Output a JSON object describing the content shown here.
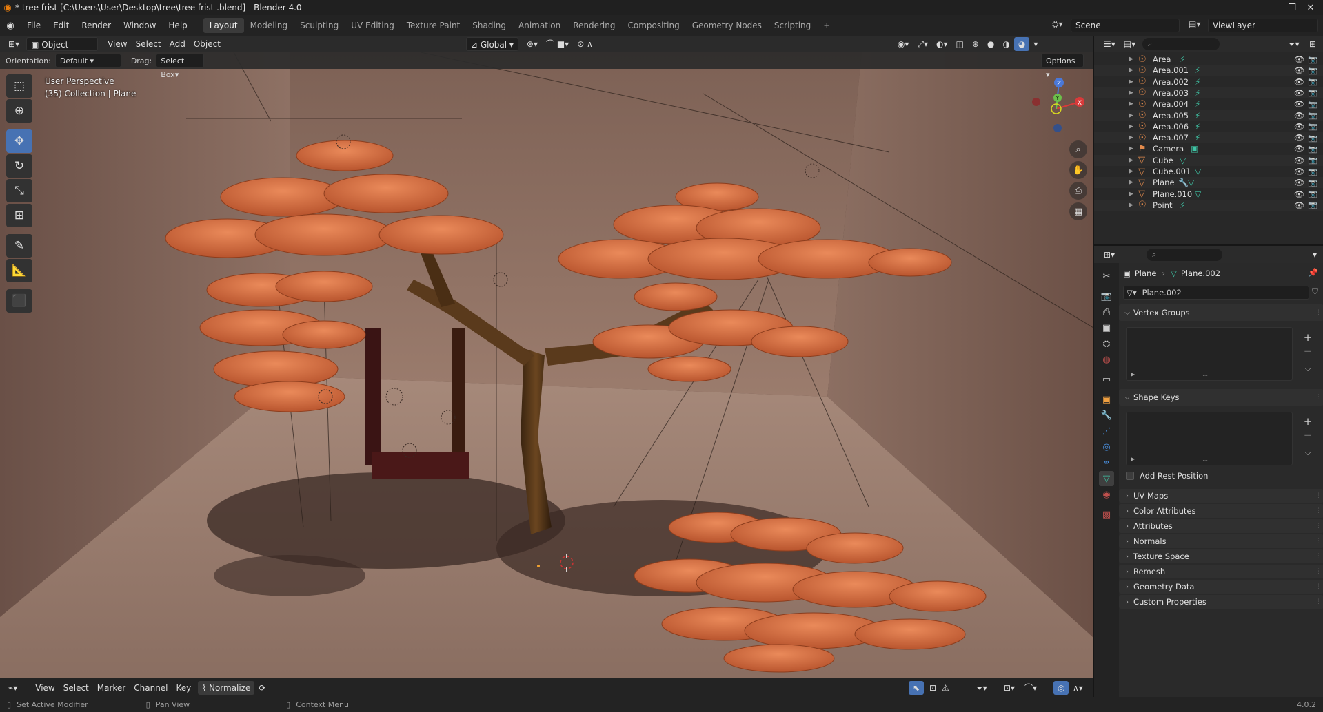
{
  "window": {
    "title": "* tree frist  [C:\\Users\\User\\Desktop\\tree\\tree frist .blend] - Blender 4.0",
    "minimize_icon": "minimize-icon",
    "maximize_icon": "restore-icon",
    "close_icon": "close-icon"
  },
  "menu": {
    "items": [
      "File",
      "Edit",
      "Render",
      "Window",
      "Help"
    ]
  },
  "workspaces": {
    "tabs": [
      "Layout",
      "Modeling",
      "Sculpting",
      "UV Editing",
      "Texture Paint",
      "Shading",
      "Animation",
      "Rendering",
      "Compositing",
      "Geometry Nodes",
      "Scripting"
    ],
    "active": "Layout",
    "add": "+"
  },
  "scene": {
    "name": "Scene",
    "view_layer": "ViewLayer"
  },
  "viewport_header": {
    "mode": "Object Mode",
    "menus": [
      "View",
      "Select",
      "Add",
      "Object"
    ],
    "transform_orientation": "Global",
    "options": "Options"
  },
  "tool_settings": {
    "orientation_label": "Orientation:",
    "orientation_value": "Default",
    "drag_label": "Drag:",
    "drag_value": "Select Box"
  },
  "viewport": {
    "perspective": "User Perspective",
    "collection": "(35) Collection | Plane",
    "axis_labels": [
      "Z",
      "Y",
      "X"
    ]
  },
  "outliner": {
    "items": [
      {
        "name": "Area",
        "type": "light"
      },
      {
        "name": "Area.001",
        "type": "light"
      },
      {
        "name": "Area.002",
        "type": "light"
      },
      {
        "name": "Area.003",
        "type": "light"
      },
      {
        "name": "Area.004",
        "type": "light"
      },
      {
        "name": "Area.005",
        "type": "light"
      },
      {
        "name": "Area.006",
        "type": "light"
      },
      {
        "name": "Area.007",
        "type": "light"
      },
      {
        "name": "Camera",
        "type": "camera"
      },
      {
        "name": "Cube",
        "type": "mesh"
      },
      {
        "name": "Cube.001",
        "type": "mesh"
      },
      {
        "name": "Plane",
        "type": "mesh"
      },
      {
        "name": "Plane.010",
        "type": "mesh"
      },
      {
        "name": "Point",
        "type": "light"
      }
    ]
  },
  "properties": {
    "breadcrumb_object": "Plane",
    "breadcrumb_data": "Plane.002",
    "mesh_name": "Plane.002",
    "panels": {
      "vertex_groups": "Vertex Groups",
      "shape_keys": "Shape Keys",
      "add_rest_position": "Add Rest Position",
      "collapsed": [
        "UV Maps",
        "Color Attributes",
        "Attributes",
        "Normals",
        "Texture Space",
        "Remesh",
        "Geometry Data",
        "Custom Properties"
      ]
    }
  },
  "timeline": {
    "menus": [
      "View",
      "Select",
      "Marker",
      "Channel",
      "Key"
    ],
    "normalize": "Normalize"
  },
  "statusbar": {
    "left": "Set Active Modifier",
    "middle": "Pan View",
    "right": "Context Menu",
    "version": "4.0.2"
  },
  "colors": {
    "accent": "#4772b3",
    "leaf": "#d26a3e",
    "trunk": "#5a3a1c",
    "wall": "#8a6a5a",
    "floor": "#a58a7c"
  }
}
